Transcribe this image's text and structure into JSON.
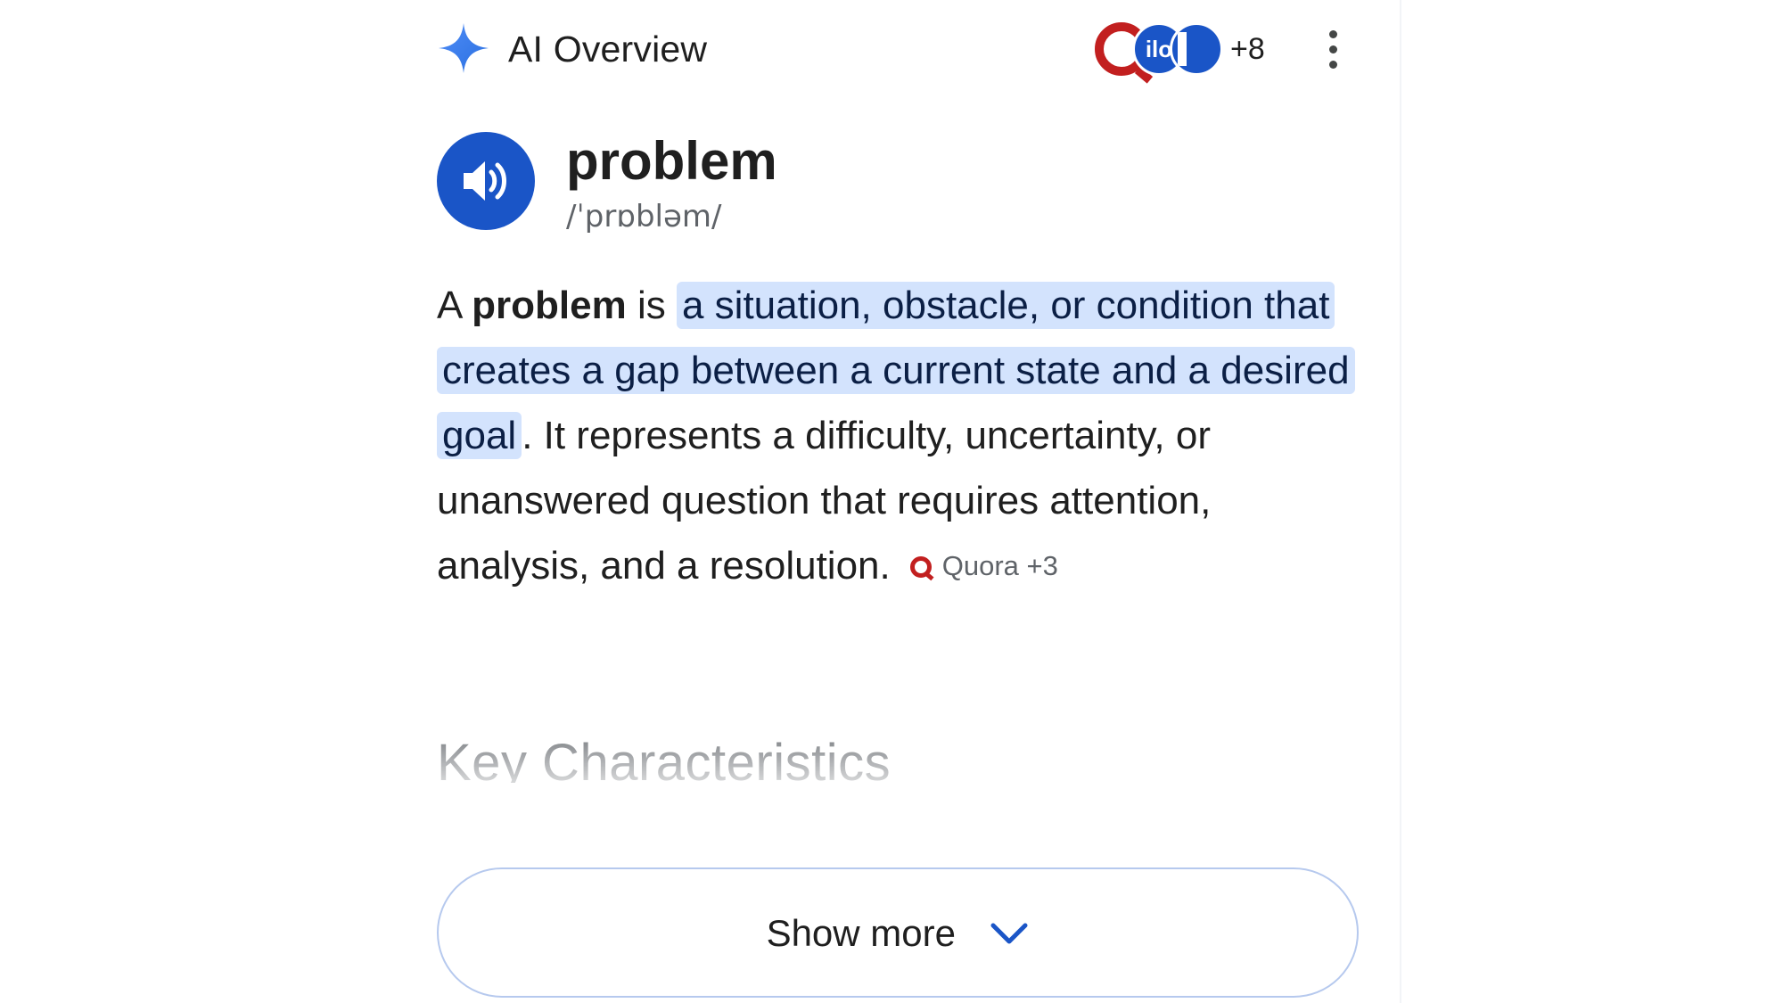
{
  "header": {
    "title": "AI Overview",
    "sources": [
      {
        "name": "Quora",
        "icon": "quora-logo-icon"
      },
      {
        "name": "ILO",
        "icon": "ilo-logo-icon",
        "label": "ilo"
      },
      {
        "name": "source",
        "icon": "source-logo-icon"
      }
    ],
    "more_sources": "+8",
    "menu_icon": "kebab-menu-icon"
  },
  "dictionary": {
    "word": "problem",
    "phonetic": "/ˈprɒbləm/",
    "audio_icon": "speaker-icon"
  },
  "definition": {
    "prefix": "A ",
    "term": "problem",
    "connector": " is ",
    "highlight": "a situation, obstacle, or condition that creates a gap between a current state and a desired goal",
    "rest": ". It represents a difficulty, uncertainty, or unanswered question that requires attention, analysis, and a resolution.",
    "citation": {
      "source": "Quora",
      "count": "+3",
      "icon": "quora-logo-icon"
    }
  },
  "section": {
    "heading": "Key Characteristics"
  },
  "show_more": {
    "label": "Show more",
    "icon": "chevron-down-icon"
  },
  "colors": {
    "accent": "#1a55c7",
    "highlight_bg": "#d3e3fd",
    "quora_red": "#c21f1f",
    "text": "#1f1f1f",
    "muted": "#5f6368",
    "button_border": "#b6c9ee"
  }
}
